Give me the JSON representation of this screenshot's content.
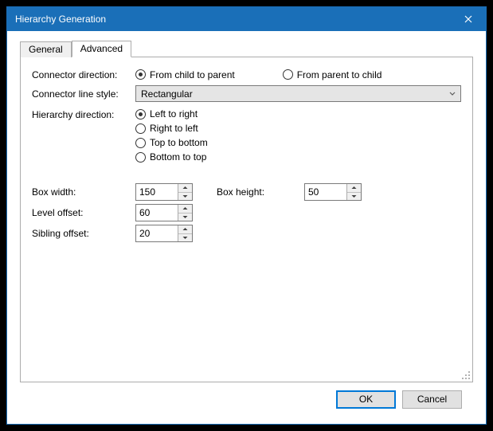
{
  "window": {
    "title": "Hierarchy Generation"
  },
  "tabs": {
    "general": "General",
    "advanced": "Advanced"
  },
  "labels": {
    "connector_direction": "Connector direction:",
    "connector_line_style": "Connector line style:",
    "hierarchy_direction": "Hierarchy direction:",
    "box_width": "Box width:",
    "box_height": "Box height:",
    "level_offset": "Level offset:",
    "sibling_offset": "Sibling offset:"
  },
  "connector_direction": {
    "from_child_to_parent": "From child to parent",
    "from_parent_to_child": "From parent to child",
    "selected": "from_child_to_parent"
  },
  "connector_line_style": {
    "value": "Rectangular"
  },
  "hierarchy_direction": {
    "left_to_right": "Left to right",
    "right_to_left": "Right to left",
    "top_to_bottom": "Top to bottom",
    "bottom_to_top": "Bottom to top",
    "selected": "left_to_right"
  },
  "values": {
    "box_width": "150",
    "box_height": "50",
    "level_offset": "60",
    "sibling_offset": "20"
  },
  "buttons": {
    "ok": "OK",
    "cancel": "Cancel"
  }
}
